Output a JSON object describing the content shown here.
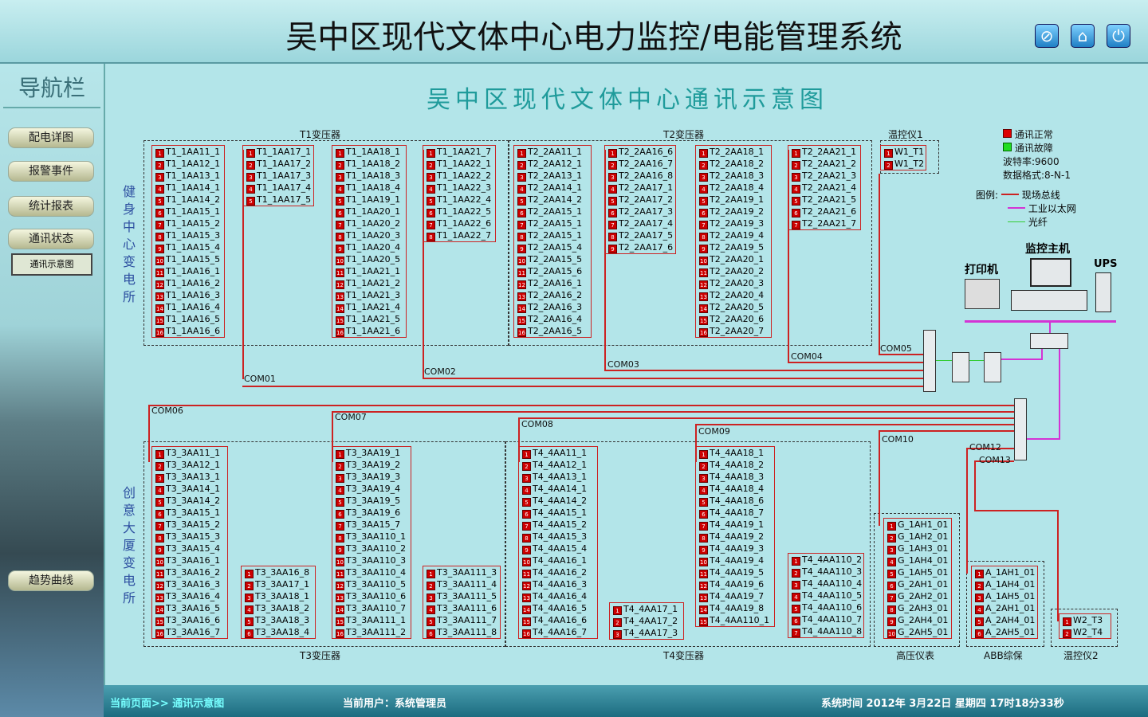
{
  "header": {
    "title": "吴中区现代文体中心电力监控/电能管理系统",
    "icons": [
      "disable-icon",
      "home-icon",
      "power-icon"
    ]
  },
  "sidebar": {
    "title": "导航栏",
    "items": [
      "配电详图",
      "报警事件",
      "统计报表",
      "通讯状态"
    ],
    "sub_item": "通讯示意图",
    "trend": "趋势曲线"
  },
  "diagram": {
    "title": "吴中区现代文体中心通讯示意图",
    "labels": {
      "t1": "T1变压器",
      "t2": "T2变压器",
      "temp1": "温控仪1",
      "t3": "T3变压器",
      "t4": "T4变压器",
      "hv": "高压仪表",
      "abb": "ABB综保",
      "temp2": "温控仪2"
    },
    "left_labels": {
      "top": "健身中心变电所",
      "bottom": "创意大厦变电所"
    },
    "coms": [
      "COM01",
      "COM02",
      "COM03",
      "COM04",
      "COM05",
      "COM06",
      "COM07",
      "COM08",
      "COM09",
      "COM10",
      "COM12",
      "COM13"
    ],
    "columns": [
      [
        "T1_1AA11_1",
        "T1_1AA12_1",
        "T1_1AA13_1",
        "T1_1AA14_1",
        "T1_1AA14_2",
        "T1_1AA15_1",
        "T1_1AA15_2",
        "T1_1AA15_3",
        "T1_1AA15_4",
        "T1_1AA15_5",
        "T1_1AA16_1",
        "T1_1AA16_2",
        "T1_1AA16_3",
        "T1_1AA16_4",
        "T1_1AA16_5",
        "T1_1AA16_6"
      ],
      [
        "T1_1AA17_1",
        "T1_1AA17_2",
        "T1_1AA17_3",
        "T1_1AA17_4",
        "T1_1AA17_5"
      ],
      [
        "T1_1AA18_1",
        "T1_1AA18_2",
        "T1_1AA18_3",
        "T1_1AA18_4",
        "T1_1AA19_1",
        "T1_1AA20_1",
        "T1_1AA20_2",
        "T1_1AA20_3",
        "T1_1AA20_4",
        "T1_1AA20_5",
        "T1_1AA21_1",
        "T1_1AA21_2",
        "T1_1AA21_3",
        "T1_1AA21_4",
        "T1_1AA21_5",
        "T1_1AA21_6"
      ],
      [
        "T1_1AA21_7",
        "T1_1AA22_1",
        "T1_1AA22_2",
        "T1_1AA22_3",
        "T1_1AA22_4",
        "T1_1AA22_5",
        "T1_1AA22_6",
        "T1_1AA22_7"
      ],
      [
        "T2_2AA11_1",
        "T2_2AA12_1",
        "T2_2AA13_1",
        "T2_2AA14_1",
        "T2_2AA14_2",
        "T2_2AA15_1",
        "T2_2AA15_1",
        "T2_2AA15_1",
        "T2_2AA15_4",
        "T2_2AA15_5",
        "T2_2AA15_6",
        "T2_2AA16_1",
        "T2_2AA16_2",
        "T2_2AA16_3",
        "T2_2AA16_4",
        "T2_2AA16_5"
      ],
      [
        "T2_2AA16_6",
        "T2_2AA16_7",
        "T2_2AA16_8",
        "T2_2AA17_1",
        "T2_2AA17_2",
        "T2_2AA17_3",
        "T2_2AA17_4",
        "T2_2AA17_5",
        "T2_2AA17_6"
      ],
      [
        "T2_2AA18_1",
        "T2_2AA18_2",
        "T2_2AA18_3",
        "T2_2AA18_4",
        "T2_2AA19_1",
        "T2_2AA19_2",
        "T2_2AA19_3",
        "T2_2AA19_4",
        "T2_2AA19_5",
        "T2_2AA20_1",
        "T2_2AA20_2",
        "T2_2AA20_3",
        "T2_2AA20_4",
        "T2_2AA20_5",
        "T2_2AA20_6",
        "T2_2AA20_7"
      ],
      [
        "T2_2AA21_1",
        "T2_2AA21_2",
        "T2_2AA21_3",
        "T2_2AA21_4",
        "T2_2AA21_5",
        "T2_2AA21_6",
        "T2_2AA21_7"
      ],
      [
        "W1_T1",
        "W1_T2"
      ],
      [
        "T3_3AA11_1",
        "T3_3AA12_1",
        "T3_3AA13_1",
        "T3_3AA14_1",
        "T3_3AA14_2",
        "T3_3AA15_1",
        "T3_3AA15_2",
        "T3_3AA15_3",
        "T3_3AA15_4",
        "T3_3AA16_1",
        "T3_3AA16_2",
        "T3_3AA16_3",
        "T3_3AA16_4",
        "T3_3AA16_5",
        "T3_3AA16_6",
        "T3_3AA16_7"
      ],
      [
        "T3_3AA16_8",
        "T3_3AA17_1",
        "T3_3AA18_1",
        "T3_3AA18_2",
        "T3_3AA18_3",
        "T3_3AA18_4"
      ],
      [
        "T3_3AA19_1",
        "T3_3AA19_2",
        "T3_3AA19_3",
        "T3_3AA19_4",
        "T3_3AA19_5",
        "T3_3AA19_6",
        "T3_3AA15_7",
        "T3_3AA110_1",
        "T3_3AA110_2",
        "T3_3AA110_3",
        "T3_3AA110_4",
        "T3_3AA110_5",
        "T3_3AA110_6",
        "T3_3AA110_7",
        "T3_3AA111_1",
        "T3_3AA111_2"
      ],
      [
        "T3_3AA111_3",
        "T3_3AA111_4",
        "T3_3AA111_5",
        "T3_3AA111_6",
        "T3_3AA111_7",
        "T3_3AA111_8"
      ],
      [
        "T4_4AA11_1",
        "T4_4AA12_1",
        "T4_4AA13_1",
        "T4_4AA14_1",
        "T4_4AA14_2",
        "T4_4AA15_1",
        "T4_4AA15_2",
        "T4_4AA15_3",
        "T4_4AA15_4",
        "T4_4AA16_1",
        "T4_4AA16_2",
        "T4_4AA16_3",
        "T4_4AA16_4",
        "T4_4AA16_5",
        "T4_4AA16_6",
        "T4_4AA16_7"
      ],
      [
        "T4_4AA17_1",
        "T4_4AA17_2",
        "T4_4AA17_3"
      ],
      [
        "T4_4AA18_1",
        "T4_4AA18_2",
        "T4_4AA18_3",
        "T4_4AA18_4",
        "T4_4AA18_6",
        "T4_4AA18_7",
        "T4_4AA19_1",
        "T4_4AA19_2",
        "T4_4AA19_3",
        "T4_4AA19_4",
        "T4_4AA19_5",
        "T4_4AA19_6",
        "T4_4AA19_7",
        "T4_4AA19_8",
        "T4_4AA110_1"
      ],
      [
        "T4_4AA110_2",
        "T4_4AA110_3",
        "T4_4AA110_4",
        "T4_4AA110_5",
        "T4_4AA110_6",
        "T4_4AA110_7",
        "T4_4AA110_8"
      ],
      [
        "G_1AH1_01",
        "G_1AH2_01",
        "G_1AH3_01",
        "G_1AH4_01",
        "G_1AH5_01",
        "G_2AH1_01",
        "G_2AH2_01",
        "G_2AH3_01",
        "G_2AH4_01",
        "G_2AH5_01"
      ],
      [
        "A_1AH1_01",
        "A_1AH4_01",
        "A_1AH5_01",
        "A_2AH1_01",
        "A_2AH4_01",
        "A_2AH5_01"
      ],
      [
        "W2_T3",
        "W2_T4"
      ]
    ],
    "legend": {
      "normal": "通讯正常",
      "fault": "通讯故障",
      "baud": "波特率:9600",
      "format": "数据格式:8-N-1",
      "legend_label": "图例:",
      "bus": "现场总线",
      "ethernet": "工业以太网",
      "fiber": "光纤",
      "colors": {
        "normal": "#dd0000",
        "fault": "#22dd22",
        "bus": "#cc2222",
        "ethernet": "#d433d4",
        "fiber": "#33cc33"
      }
    },
    "equipment": {
      "printer": "打印机",
      "host": "监控主机",
      "ups": "UPS"
    }
  },
  "footer": {
    "page": "当前页面>> 通讯示意图",
    "user": "当前用户：系统管理员",
    "time": "系统时间 2012年 3月22日 星期四 17时18分33秒"
  }
}
